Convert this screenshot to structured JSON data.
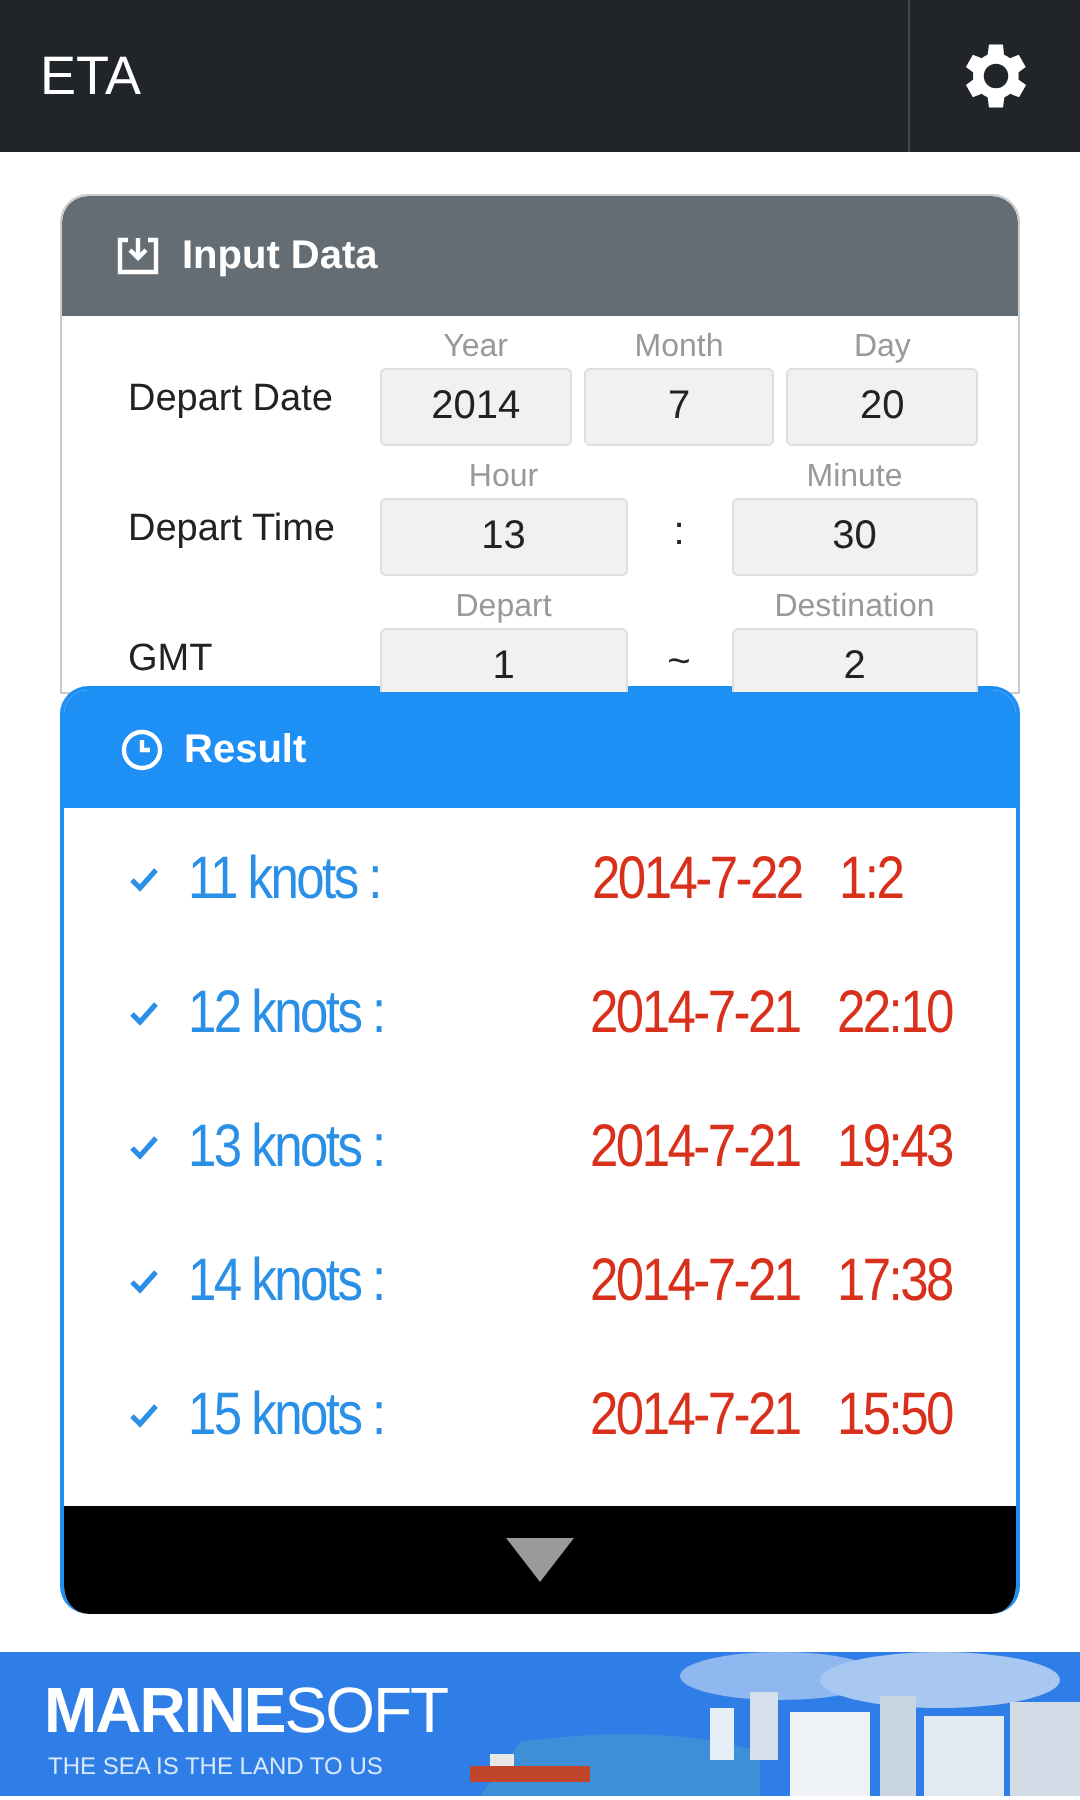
{
  "app_bar": {
    "title": "ETA"
  },
  "input_panel": {
    "title": "Input Data",
    "rows": [
      {
        "label": "Depart Date",
        "separator": "",
        "fields": [
          {
            "caption": "Year",
            "value": "2014"
          },
          {
            "caption": "Month",
            "value": "7"
          },
          {
            "caption": "Day",
            "value": "20"
          }
        ]
      },
      {
        "label": "Depart Time",
        "separator": ":",
        "fields": [
          {
            "caption": "Hour",
            "value": "13"
          },
          {
            "caption": "Minute",
            "value": "30"
          }
        ]
      },
      {
        "label": "GMT",
        "separator": "~",
        "fields": [
          {
            "caption": "Depart",
            "value": "1"
          },
          {
            "caption": "Destination",
            "value": "2"
          }
        ]
      }
    ]
  },
  "result_panel": {
    "title": "Result",
    "items": [
      {
        "speed": "11 knots :",
        "date": "2014-7-22",
        "time": "1:2"
      },
      {
        "speed": "12 knots :",
        "date": "2014-7-21",
        "time": "22:10"
      },
      {
        "speed": "13 knots :",
        "date": "2014-7-21",
        "time": "19:43"
      },
      {
        "speed": "14 knots :",
        "date": "2014-7-21",
        "time": "17:38"
      },
      {
        "speed": "15 knots :",
        "date": "2014-7-21",
        "time": "15:50"
      }
    ]
  },
  "banner": {
    "brand_bold": "MARINE",
    "brand_light": "SOFT",
    "slogan": "THE SEA IS THE LAND TO US"
  }
}
